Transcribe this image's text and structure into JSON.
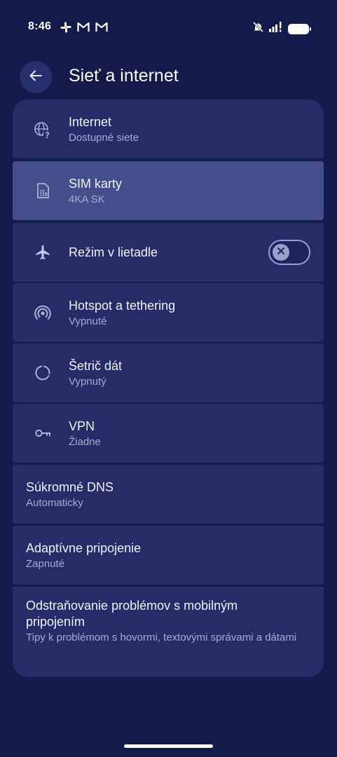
{
  "status_bar": {
    "time": "8:46",
    "notification_icons": [
      "slack-icon",
      "gmail-icon",
      "gmail-icon"
    ],
    "right_icons": [
      "mute-icon",
      "signal-icon",
      "battery-icon"
    ]
  },
  "header": {
    "back_icon": "arrow-left-icon",
    "title": "Sieť a internet"
  },
  "colors": {
    "background": "#141a4a",
    "card": "#252c68",
    "card_selected": "#444e8a",
    "subtitle": "#a7acd2"
  },
  "settings": {
    "internet": {
      "title": "Internet",
      "subtitle": "Dostupné siete",
      "icon": "globe-question-icon"
    },
    "sim": {
      "title": "SIM karty",
      "subtitle": "4KA SK",
      "icon": "sim-card-icon",
      "selected": true
    },
    "airplane": {
      "title": "Režim v lietadle",
      "icon": "airplane-icon",
      "toggle_on": false
    },
    "hotspot": {
      "title": "Hotspot a tethering",
      "subtitle": "Vypnuté",
      "icon": "hotspot-icon"
    },
    "data_saver": {
      "title": "Šetrič dát",
      "subtitle": "Vypnutý",
      "icon": "data-saver-icon"
    },
    "vpn": {
      "title": "VPN",
      "subtitle": "Žiadne",
      "icon": "key-icon"
    },
    "private_dns": {
      "title": "Súkromné DNS",
      "subtitle": "Automaticky"
    },
    "adaptive": {
      "title": "Adaptívne pripojenie",
      "subtitle": "Zapnuté"
    },
    "troubleshoot": {
      "title": "Odstraňovanie problémov s mobilným pripojením",
      "subtitle": "Tipy k problémom s hovormi, textovými správami a dátami"
    }
  }
}
